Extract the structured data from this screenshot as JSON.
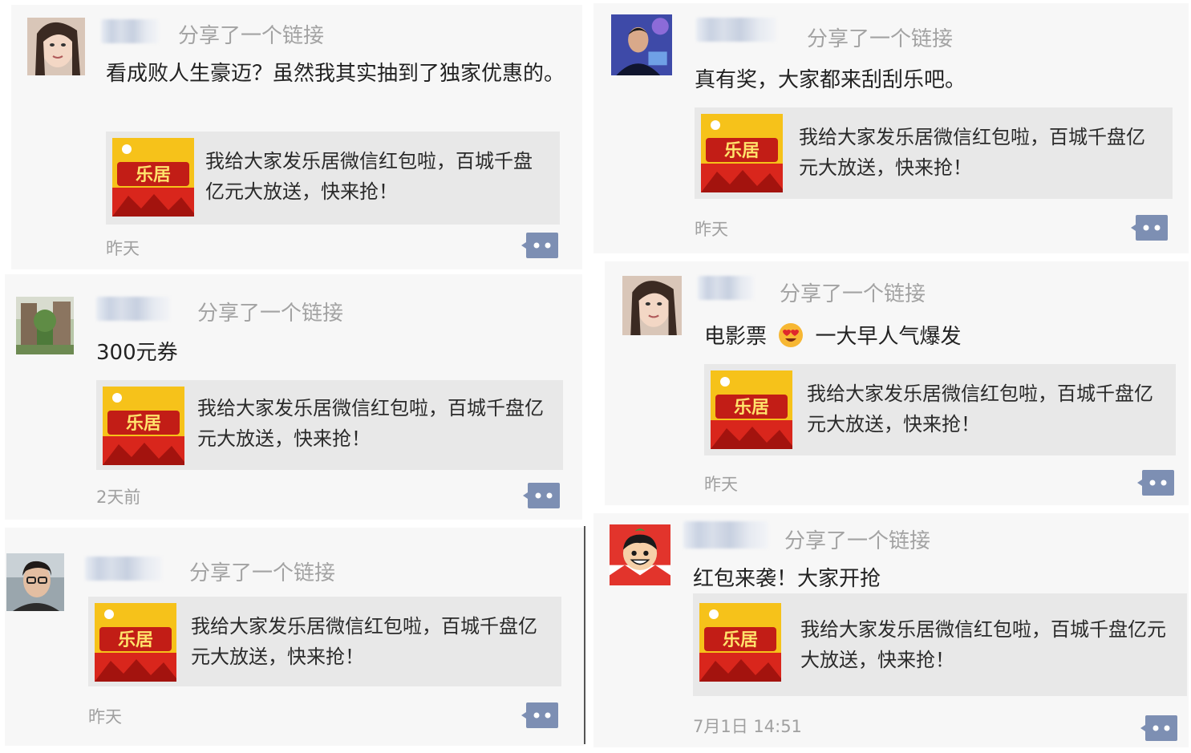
{
  "posts": [
    {
      "id": "p1",
      "share_label": "分享了一个链接",
      "text": "看成败人生豪迈？虽然我其实抽到了独家优惠的。",
      "card_text": "我给大家发乐居微信红包啦，百城千盘亿元大放送，快来抢！",
      "time": "昨天",
      "avatar_icon": "woman-selfie-avatar"
    },
    {
      "id": "p2",
      "share_label": "分享了一个链接",
      "text": "300元券",
      "card_text": "我给大家发乐居微信红包啦，百城千盘亿元大放送，快来抢！",
      "time": "2天前",
      "avatar_icon": "garden-photo-avatar"
    },
    {
      "id": "p3",
      "share_label": "分享了一个链接",
      "text": "",
      "card_text": "我给大家发乐居微信红包啦，百城千盘亿元大放送，快来抢！",
      "time": "昨天",
      "avatar_icon": "man-glasses-avatar"
    },
    {
      "id": "p4",
      "share_label": "分享了一个链接",
      "text": "真有奖，大家都来刮刮乐吧。",
      "card_text": "我给大家发乐居微信红包啦，百城千盘亿元大放送，快来抢！",
      "time": "昨天",
      "avatar_icon": "man-stage-avatar"
    },
    {
      "id": "p5",
      "share_label": "分享了一个链接",
      "text_before_emoji": "电影票",
      "text_after_emoji": "一大早人气爆发",
      "emoji_icon": "heart-eyes-emoji-icon",
      "card_text": "我给大家发乐居微信红包啦，百城千盘亿元大放送，快来抢！",
      "time": "昨天",
      "avatar_icon": "woman-selfie-avatar"
    },
    {
      "id": "p6",
      "share_label": "分享了一个链接",
      "text": "红包来袭！大家开抢",
      "card_text": "我给大家发乐居微信红包啦，百城千盘亿元大放送，快来抢！",
      "time": "7月1日 14:51",
      "avatar_icon": "cartoon-boy-avatar"
    }
  ],
  "colors": {
    "post_bg": "#f7f7f7",
    "card_bg": "#e8e8e8",
    "share_text": "#a3a3a3",
    "comment_button": "#7d8fb3",
    "thumb_red": "#d9261c",
    "thumb_yellow": "#f6c21a"
  }
}
